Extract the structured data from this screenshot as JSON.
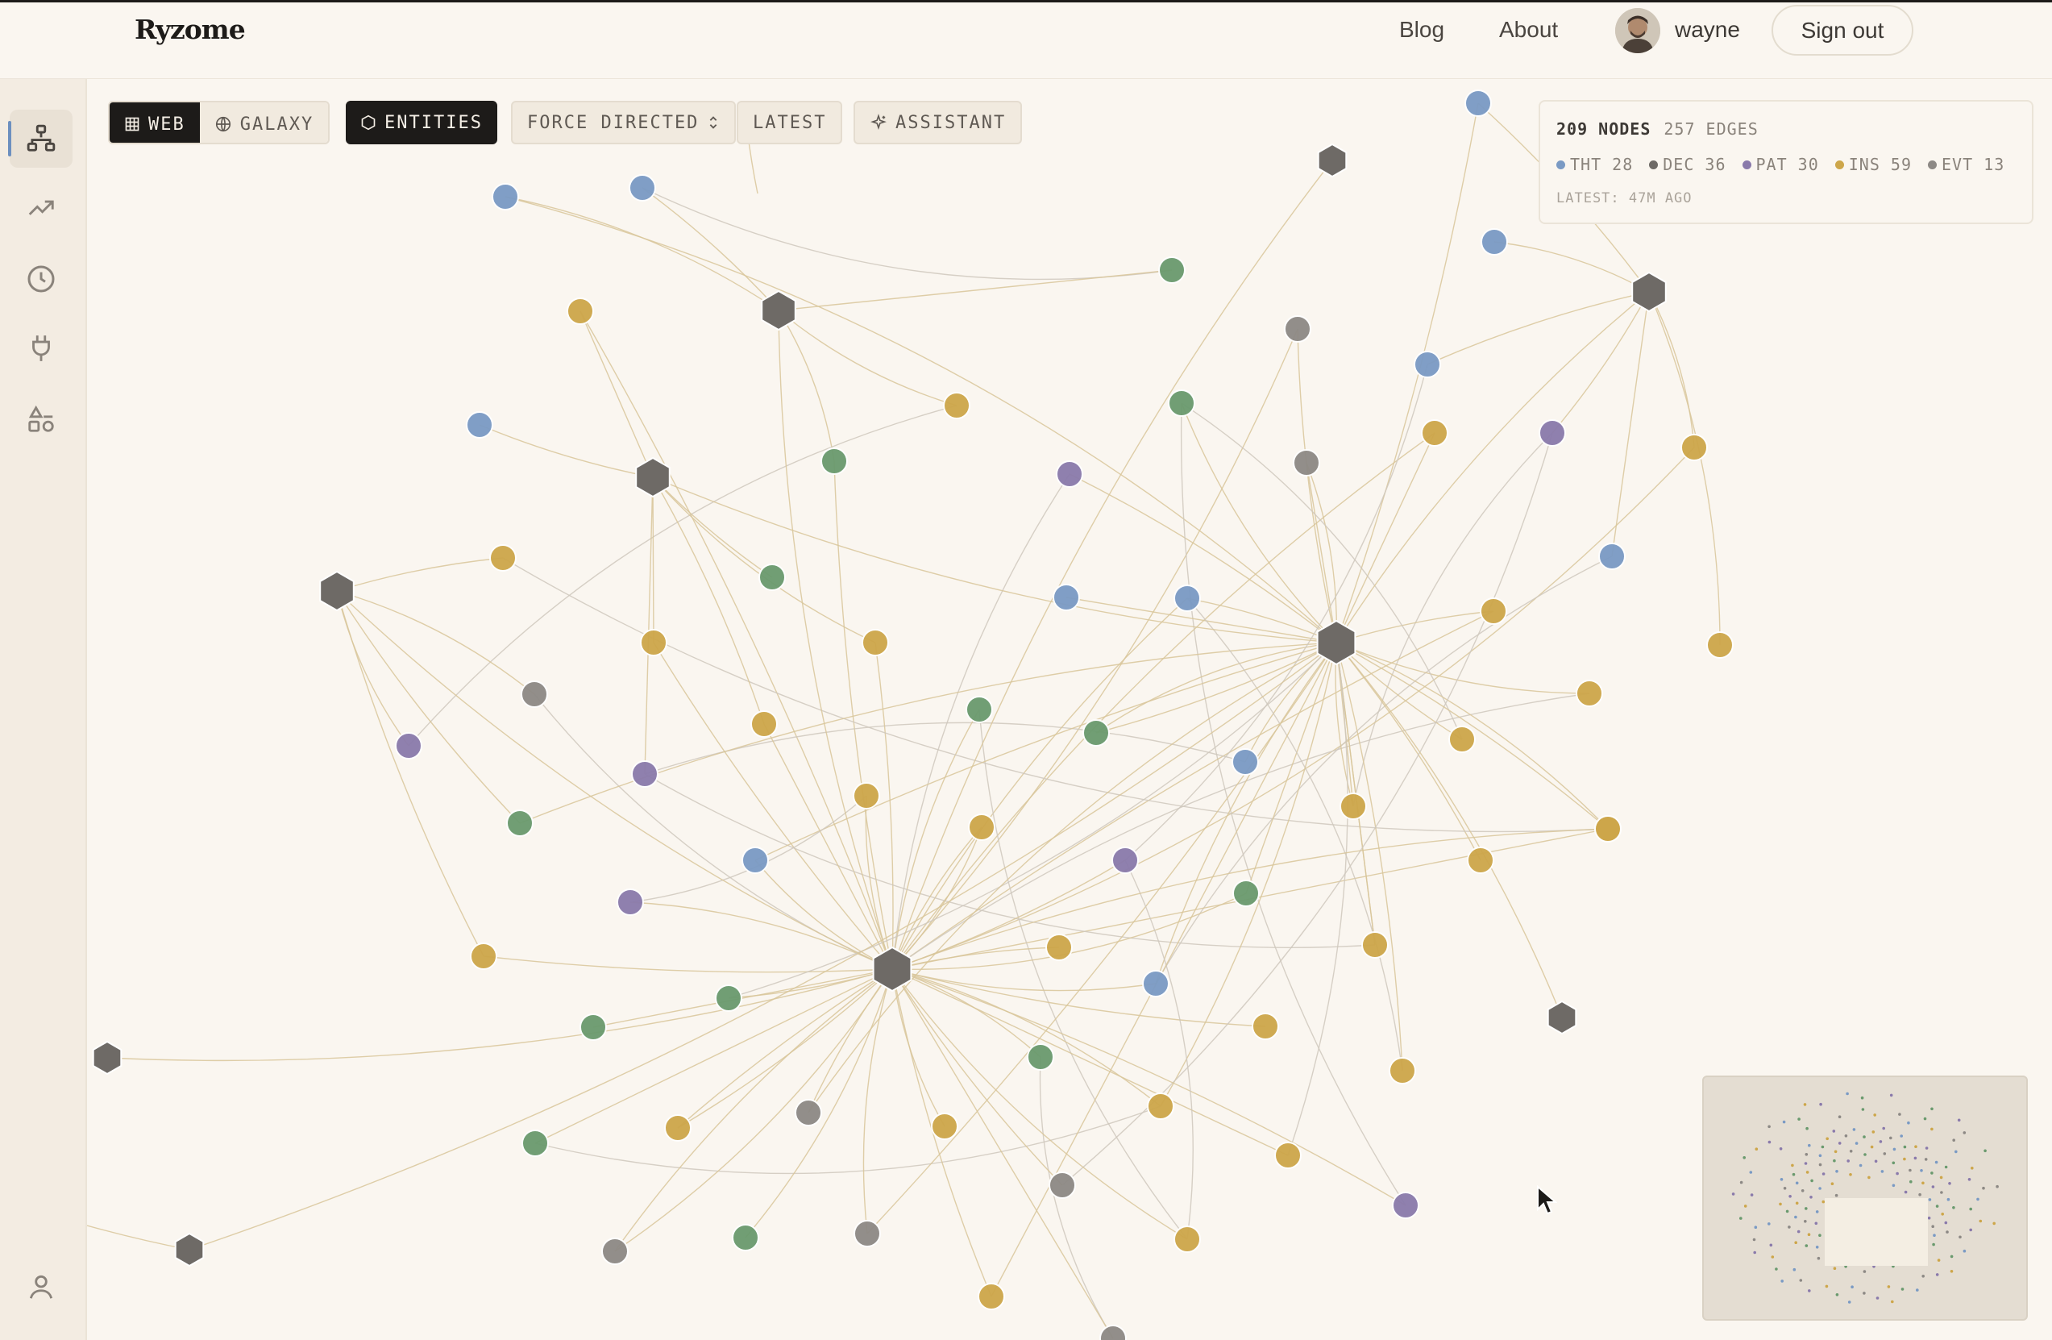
{
  "header": {
    "brand": "Ryzome",
    "nav": [
      "Blog",
      "About"
    ],
    "username": "wayne",
    "signout_label": "Sign out"
  },
  "sidebar": {
    "items": [
      {
        "icon": "network-icon",
        "active": true
      },
      {
        "icon": "trending-icon",
        "active": false
      },
      {
        "icon": "clock-icon",
        "active": false
      },
      {
        "icon": "plug-icon",
        "active": false
      },
      {
        "icon": "shapes-icon",
        "active": false
      },
      {
        "icon": "user-icon",
        "active": false
      }
    ]
  },
  "toolbar": {
    "web_label": "WEB",
    "galaxy_label": "GALAXY",
    "entities_label": "ENTITIES",
    "layout_label": "FORCE DIRECTED",
    "latest_label": "LATEST",
    "assistant_label": "ASSISTANT"
  },
  "stats": {
    "nodes": "209 NODES",
    "edges": "257 EDGES",
    "legend": [
      {
        "label": "THT 28",
        "color": "#7a9ac4"
      },
      {
        "label": "DEC 36",
        "color": "#6e6a66"
      },
      {
        "label": "PAT 30",
        "color": "#8a7aab"
      },
      {
        "label": "INS 59",
        "color": "#cda64a"
      },
      {
        "label": "EVT 13",
        "color": "#8d8985"
      }
    ],
    "latest": "LATEST: 47M AGO"
  },
  "colors": {
    "tht": "#7a9ac4",
    "dec": "#6e6a66",
    "pat": "#8a7aab",
    "ins": "#cda64a",
    "evt": "#8d8985",
    "grn": "#6a9a6e",
    "edge": "#d8c59a",
    "accent": "#6c8fbf"
  }
}
